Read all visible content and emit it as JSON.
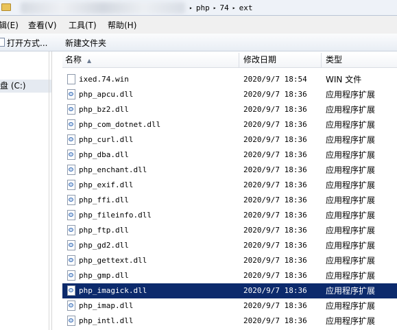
{
  "address": {
    "crumbs": [
      "php",
      "74",
      "ext"
    ]
  },
  "menu": {
    "items": [
      {
        "label": "辑(E)"
      },
      {
        "label": "查看(V)"
      },
      {
        "label": "工具(T)"
      },
      {
        "label": "帮助(H)"
      }
    ]
  },
  "toolbar": {
    "open_with_label": "打开方式...",
    "new_folder_label": "新建文件夹"
  },
  "nav": {
    "drive_label": "盘 (C:)"
  },
  "columns": {
    "name": "名称",
    "date": "修改日期",
    "type": "类型"
  },
  "files": [
    {
      "name": "ixed.74.win",
      "date": "2020/9/7 18:54",
      "type": "WIN 文件",
      "icon": "file-icon"
    },
    {
      "name": "php_apcu.dll",
      "date": "2020/9/7 18:36",
      "type": "应用程序扩展",
      "icon": "dll-icon"
    },
    {
      "name": "php_bz2.dll",
      "date": "2020/9/7 18:36",
      "type": "应用程序扩展",
      "icon": "dll-icon"
    },
    {
      "name": "php_com_dotnet.dll",
      "date": "2020/9/7 18:36",
      "type": "应用程序扩展",
      "icon": "dll-icon"
    },
    {
      "name": "php_curl.dll",
      "date": "2020/9/7 18:36",
      "type": "应用程序扩展",
      "icon": "dll-icon"
    },
    {
      "name": "php_dba.dll",
      "date": "2020/9/7 18:36",
      "type": "应用程序扩展",
      "icon": "dll-icon"
    },
    {
      "name": "php_enchant.dll",
      "date": "2020/9/7 18:36",
      "type": "应用程序扩展",
      "icon": "dll-icon"
    },
    {
      "name": "php_exif.dll",
      "date": "2020/9/7 18:36",
      "type": "应用程序扩展",
      "icon": "dll-icon"
    },
    {
      "name": "php_ffi.dll",
      "date": "2020/9/7 18:36",
      "type": "应用程序扩展",
      "icon": "dll-icon"
    },
    {
      "name": "php_fileinfo.dll",
      "date": "2020/9/7 18:36",
      "type": "应用程序扩展",
      "icon": "dll-icon"
    },
    {
      "name": "php_ftp.dll",
      "date": "2020/9/7 18:36",
      "type": "应用程序扩展",
      "icon": "dll-icon"
    },
    {
      "name": "php_gd2.dll",
      "date": "2020/9/7 18:36",
      "type": "应用程序扩展",
      "icon": "dll-icon"
    },
    {
      "name": "php_gettext.dll",
      "date": "2020/9/7 18:36",
      "type": "应用程序扩展",
      "icon": "dll-icon"
    },
    {
      "name": "php_gmp.dll",
      "date": "2020/9/7 18:36",
      "type": "应用程序扩展",
      "icon": "dll-icon"
    },
    {
      "name": "php_imagick.dll",
      "date": "2020/9/7 18:36",
      "type": "应用程序扩展",
      "icon": "dll-icon",
      "selected": true
    },
    {
      "name": "php_imap.dll",
      "date": "2020/9/7 18:36",
      "type": "应用程序扩展",
      "icon": "dll-icon"
    },
    {
      "name": "php_intl.dll",
      "date": "2020/9/7 18:36",
      "type": "应用程序扩展",
      "icon": "dll-icon"
    }
  ],
  "colors": {
    "selection": "#0c2a6c",
    "selection_text": "#ffffff"
  }
}
